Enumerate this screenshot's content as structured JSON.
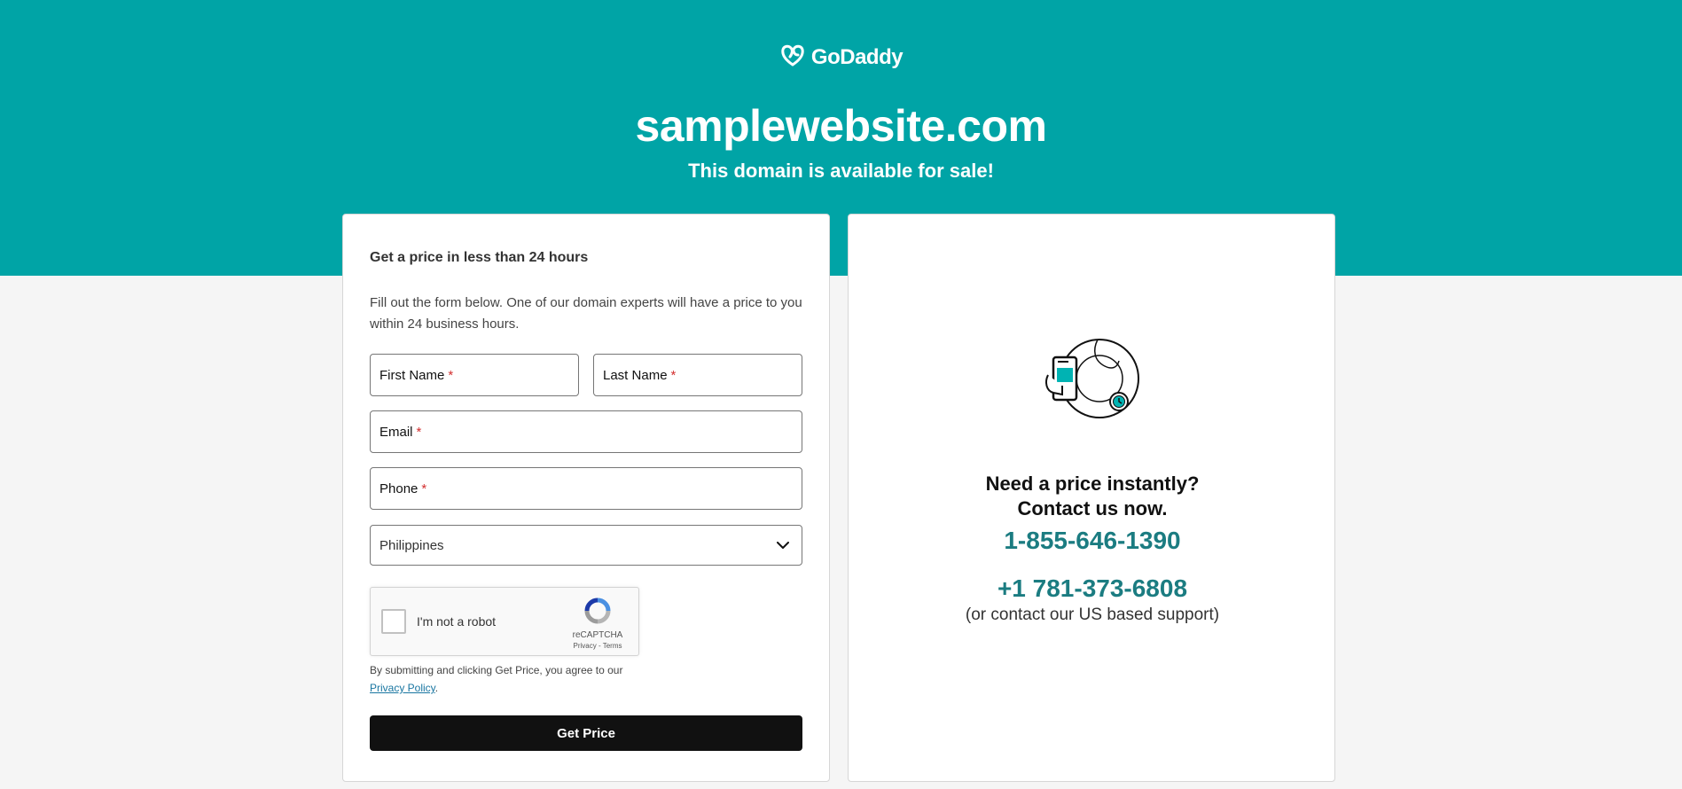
{
  "brand": {
    "name": "GoDaddy",
    "accent_color": "#00a4a6",
    "button_color": "#111111",
    "link_color": "#1b7c81"
  },
  "header": {
    "domain": "samplewebsite.com",
    "subtitle": "This domain is available for sale!"
  },
  "form": {
    "heading": "Get a price in less than 24 hours",
    "description": "Fill out the form below. One of our domain experts will have a price to you within 24 business hours.",
    "fields": {
      "first_name": "First Name",
      "last_name": "Last Name",
      "email": "Email",
      "phone": "Phone",
      "required_mark": "*"
    },
    "country": {
      "selected": "Philippines",
      "icon": "chevron-down-icon"
    },
    "captcha": {
      "label": "I'm not a robot",
      "brand": "reCAPTCHA",
      "privacy": "Privacy",
      "separator": "-",
      "terms": "Terms"
    },
    "agreement": {
      "text": "By submitting and clicking Get Price, you agree to our",
      "link": "Privacy Policy",
      "suffix": "."
    },
    "submit_label": "Get Price"
  },
  "contact": {
    "illustration_icon": "phone-with-clock-icon",
    "heading_line1": "Need a price instantly?",
    "heading_line2": "Contact us now.",
    "phone_primary": "1-855-646-1390",
    "phone_us": "+1 781-373-6808",
    "phone_us_note": "(or contact our US based support)"
  }
}
